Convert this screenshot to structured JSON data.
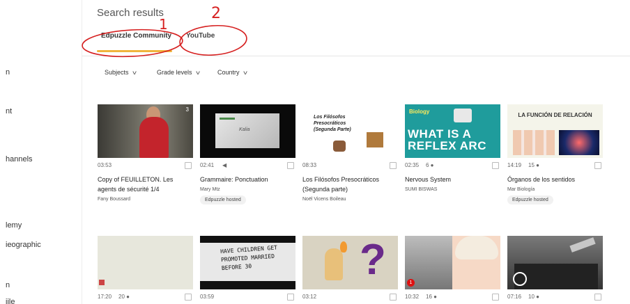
{
  "sidebar": {
    "items": [
      {
        "label": "n"
      },
      {
        "label": "nt"
      },
      {
        "label": "hannels"
      },
      {
        "label": "lemy"
      },
      {
        "label": "ieographic"
      },
      {
        "label": "n"
      },
      {
        "label": "iile"
      }
    ]
  },
  "header": {
    "title": "Search results",
    "tabs": [
      {
        "label": "Edpuzzle Community",
        "active": true
      },
      {
        "label": "YouTube",
        "active": false
      }
    ]
  },
  "annotations": {
    "one": "1",
    "two": "2"
  },
  "filters": [
    {
      "label": "Subjects"
    },
    {
      "label": "Grade levels"
    },
    {
      "label": "Country"
    }
  ],
  "colors": {
    "accent_underline": "#f0b43c",
    "annotation": "#d62020"
  },
  "cards": [
    {
      "duration": "03:53",
      "extra": "",
      "title": "Copy of FEUILLETON. Les agents de sécurité 1/4",
      "author": "Fany Boussard",
      "badge": "",
      "thumb_count": "3"
    },
    {
      "duration": "02:41",
      "extra": "◀",
      "title": "Grammaire: Ponctuation",
      "author": "Mary Mtz",
      "badge": "Edpuzzle hosted",
      "thumb_text": "Kalia"
    },
    {
      "duration": "08:33",
      "extra": "",
      "title": "Los Filósofos Presocráticos (Segunda parte)",
      "author": "Noël Vicens Boileau",
      "badge": "",
      "thumb_text": "Los Filósofos Presocráticos (Segunda Parte)"
    },
    {
      "duration": "02:35",
      "extra": "6 ●",
      "title": "Nervous System",
      "author": "SUMI BISWAS",
      "badge": "",
      "thumb_text": "WHAT IS A REFLEX ARC",
      "thumb_label": "Biology"
    },
    {
      "duration": "14:19",
      "extra": "15 ●",
      "title": "Órganos de los sentidos",
      "author": "Mar Biología",
      "badge": "Edpuzzle hosted",
      "thumb_text": "LA FUNCIÓN DE RELACIÓN"
    },
    {
      "duration": "17:20",
      "extra": "20 ●"
    },
    {
      "duration": "03:59",
      "extra": "",
      "thumb_text": "HAVE CHILDREN GET PROMOTED MARRIED BEFORE 30"
    },
    {
      "duration": "03:12",
      "extra": ""
    },
    {
      "duration": "10:32",
      "extra": "16 ●",
      "thumb_badge": "1"
    },
    {
      "duration": "07:16",
      "extra": "10 ●"
    }
  ]
}
